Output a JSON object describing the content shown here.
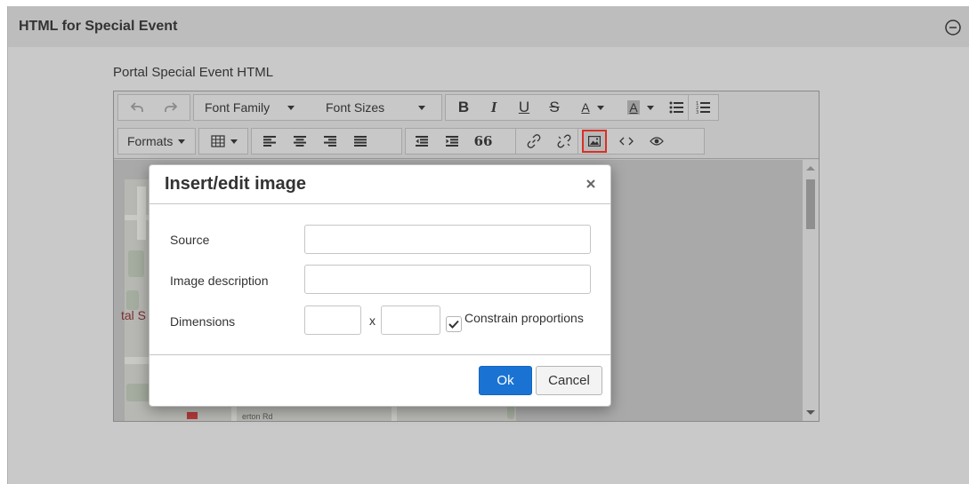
{
  "panel": {
    "title": "HTML for Special Event",
    "collapse_icon": "minus-circle-icon"
  },
  "field": {
    "label": "Portal Special Event HTML"
  },
  "toolbar": {
    "font_family_label": "Font Family",
    "font_sizes_label": "Font Sizes",
    "bold_label": "B",
    "italic_label": "I",
    "underline_label": "U",
    "strike_label": "S",
    "text_color_label": "A",
    "bg_color_label": "A",
    "formats_label": "Formats",
    "blockquote_label": "66",
    "icons": [
      "undo-icon",
      "redo-icon",
      "bullet-list-icon",
      "numbered-list-icon",
      "table-icon",
      "align-left-icon",
      "align-center-icon",
      "align-right-icon",
      "align-justify-icon",
      "outdent-icon",
      "indent-icon",
      "blockquote-icon",
      "link-icon",
      "unlink-icon",
      "image-icon",
      "code-icon",
      "preview-icon"
    ]
  },
  "content": {
    "map_text": "tal S",
    "map_road_label": "erton Rd"
  },
  "dialog": {
    "title": "Insert/edit image",
    "close_label": "×",
    "source_label": "Source",
    "source_value": "",
    "description_label": "Image description",
    "description_value": "",
    "dimensions_label": "Dimensions",
    "width_value": "",
    "height_value": "",
    "dimensions_separator": "x",
    "constrain_label": "Constrain proportions",
    "constrain_checked": true,
    "ok_label": "Ok",
    "cancel_label": "Cancel"
  },
  "colors": {
    "ok_button": "#1a73d3",
    "highlight": "#d93025"
  }
}
